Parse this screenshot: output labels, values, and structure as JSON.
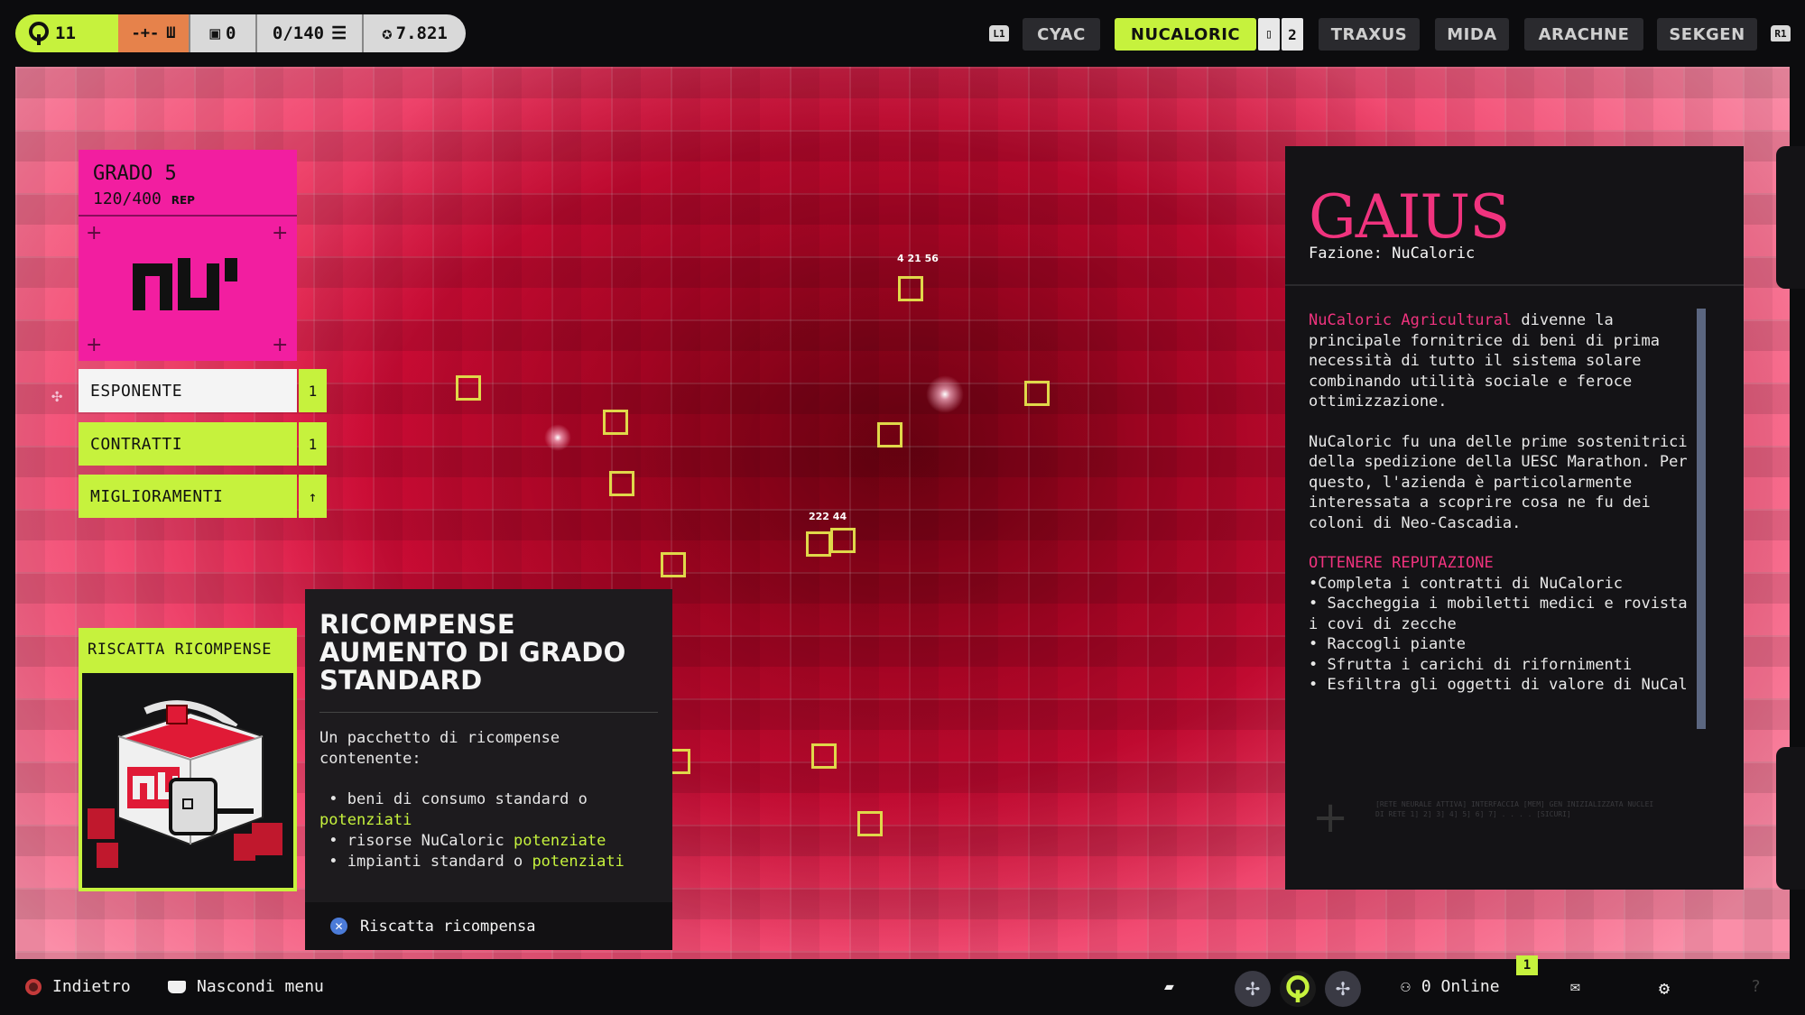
{
  "hud": {
    "level": "11",
    "inventory_count": "0",
    "capacity": "0/140",
    "currency": "7.821"
  },
  "tabs": [
    {
      "label": "CYAC"
    },
    {
      "label": "NUCALORIC",
      "badge": "2"
    },
    {
      "label": "TRAXUS"
    },
    {
      "label": "MIDA"
    },
    {
      "label": "ARACHNE"
    },
    {
      "label": "SEKGEN"
    }
  ],
  "bumpers": {
    "left": "L1",
    "right": "R1"
  },
  "map": {
    "label_top": "4 21 56",
    "label_mid": "222 44"
  },
  "faction_card": {
    "grade": "GRADO 5",
    "rep_value": "120/400",
    "rep_unit": "REP",
    "logo_text": "nu"
  },
  "menu": [
    {
      "label": "ESPONENTE",
      "value": "1"
    },
    {
      "label": "CONTRATTI",
      "value": "1"
    },
    {
      "label": "MIGLIORAMENTI",
      "value": "↑"
    }
  ],
  "rewards": {
    "title": "RISCATTA RICOMPENSE"
  },
  "tooltip": {
    "title": "RICOMPENSE AUMENTO DI GRADO STANDARD",
    "description": "Un pacchetto di ricompense contenente:",
    "items": [
      {
        "text": "beni di consumo standard o",
        "highlight": "potenziati"
      },
      {
        "text": "risorse NuCaloric",
        "highlight": "potenziate"
      },
      {
        "text": "impianti standard o",
        "highlight": "potenziati"
      }
    ],
    "action": "Riscatta ricompensa"
  },
  "lore": {
    "name": "GAIUS",
    "faction": "Fazione: NuCaloric",
    "p1_highlight": "NuCaloric Agricultural",
    "p1_rest": "divenne la principale fornitrice di beni di prima necessità di tutto il sistema solare combinando utilità sociale e feroce ottimizzazione.",
    "p2": "NuCaloric fu una delle prime sostenitrici della spedizione della UESC Marathon. Per questo, l'azienda è particolarmente interessata a scoprire cosa ne fu dei coloni di Neo-Cascadia.",
    "rep_heading": "OTTENERE REPUTAZIONE",
    "rep_items": [
      "•Completa i contratti di NuCaloric",
      "• Saccheggia i mobiletti medici e rovista i covi di zecche",
      "• Raccogli piante",
      "• Sfrutta i carichi di rifornimenti",
      "• Esfiltra gli oggetti di valore di NuCal"
    ],
    "fine_print": "[RETE NEURALE ATTIVA] INTERFACCIA [MEM] GEN INIZIALIZZATA NUCLEI DI RETE 1] 2] 3] 4] 5] 6] 7] . . . . [SICURI]"
  },
  "bottom": {
    "back": "Indietro",
    "hide_menu": "Nascondi menu",
    "online": "0 Online",
    "badge": "1"
  }
}
